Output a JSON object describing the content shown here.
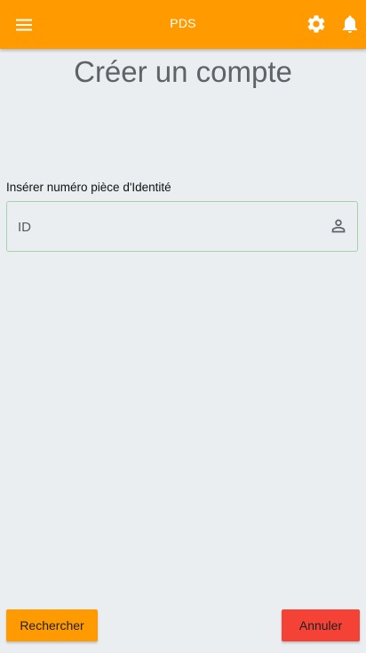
{
  "app_bar": {
    "title": "PDS",
    "menu_icon": "menu-icon",
    "settings_icon": "gear-icon",
    "notification_icon": "bell-icon",
    "color": "#ff9b00"
  },
  "page": {
    "title": "Créer un compte"
  },
  "form": {
    "id_label": "Insérer numéro pièce d'Identité",
    "id_placeholder": "ID",
    "id_value": "",
    "id_icon": "person-icon"
  },
  "actions": {
    "search_label": "Rechercher",
    "search_color": "#ff9b00",
    "cancel_label": "Annuler",
    "cancel_color": "#f44336"
  }
}
